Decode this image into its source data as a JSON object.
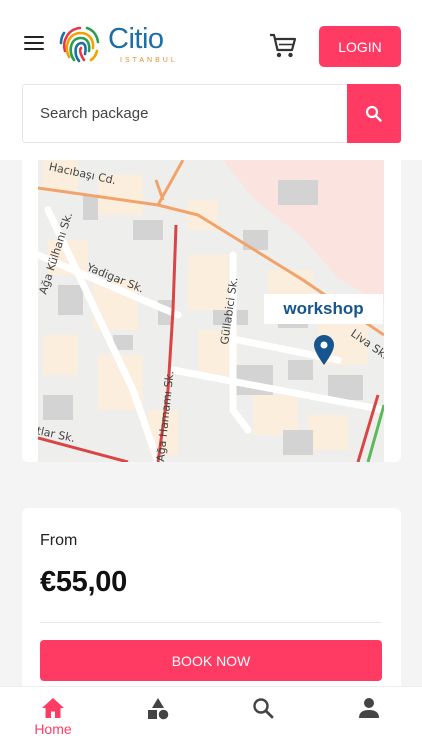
{
  "header": {
    "logo_name": "Citio",
    "logo_sub": "ISTANBUL",
    "login_label": "LOGIN"
  },
  "search": {
    "placeholder": "Search package"
  },
  "map": {
    "marker_label": "workshop",
    "streets": [
      "Hacıbaşı Cd.",
      "Ağa Külhanı Sk.",
      "Yadigar Sk.",
      "Güllabici Sk.",
      "Ağa Hamamı Sk.",
      "Liva Sk.",
      "tlar Sk."
    ]
  },
  "pricing": {
    "from_label": "From",
    "price": "€55,00",
    "book_label": "BOOK NOW"
  },
  "bottom_nav": {
    "home_label": "Home",
    "active": "home"
  },
  "colors": {
    "accent": "#ff3b63",
    "brand_blue": "#1c6fa4",
    "marker": "#17558e"
  }
}
